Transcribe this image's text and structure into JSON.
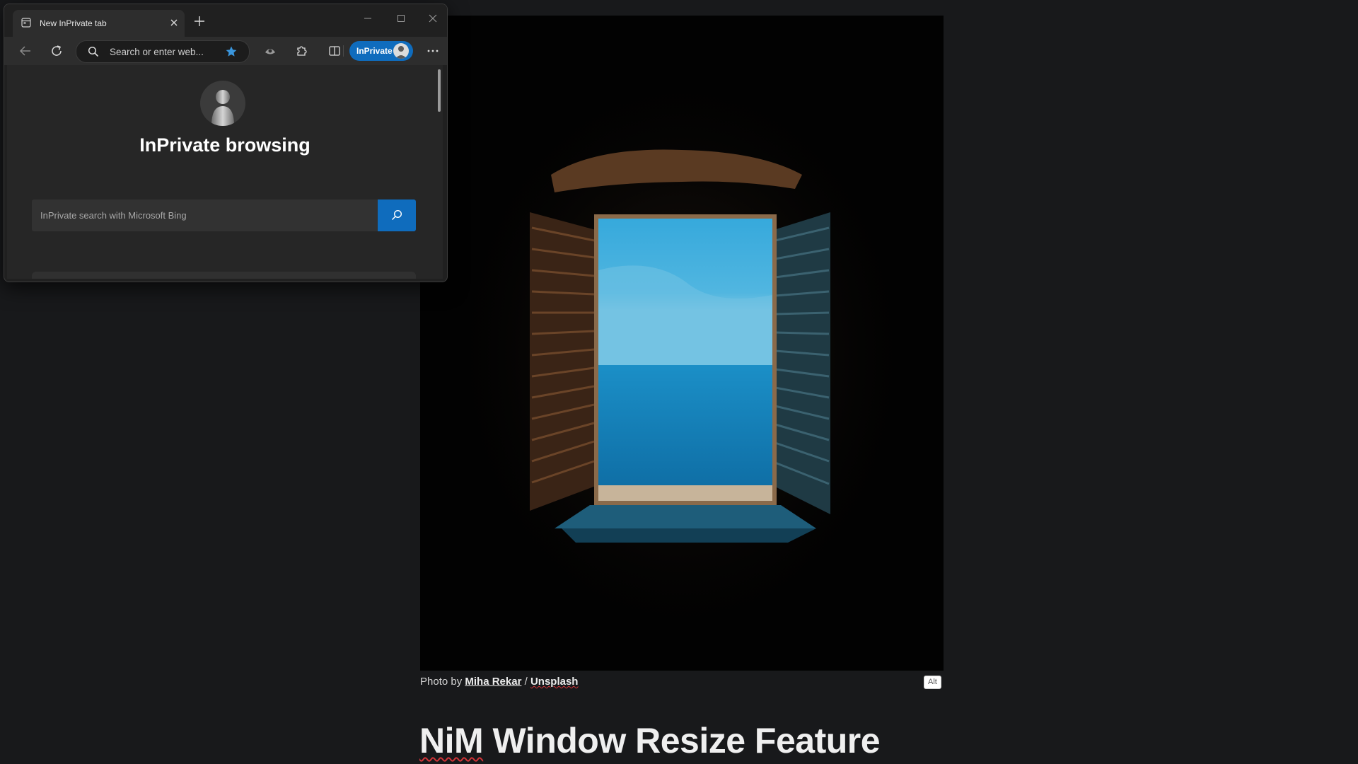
{
  "document": {
    "photo_alt": "Dark room with an open window with wooden shutters looking out on the sea",
    "caption": {
      "prefix": "Photo by ",
      "author": "Miha Rekar",
      "separator": " / ",
      "source": "Unsplash"
    },
    "alt_badge": "Alt",
    "title_first": "NiM",
    "title_rest": " Window Resize Feature"
  },
  "browser": {
    "tab": {
      "title": "New InPrivate tab",
      "icon": "inprivate-page-icon",
      "close_icon": "close-icon"
    },
    "new_tab_icon": "plus-icon",
    "window_controls": [
      "minimize-icon",
      "maximize-icon",
      "close-icon"
    ],
    "toolbar": {
      "back_icon": "back-arrow-icon",
      "refresh_icon": "refresh-icon",
      "address_placeholder": "Search or enter web...",
      "favorite_icon": "star-icon",
      "extension_icons": [
        "tracking-icon",
        "extensions-puzzle-icon",
        "split-screen-icon"
      ],
      "inprivate_label": "InPrivate",
      "more_icon": "ellipsis-icon"
    },
    "new_tab_page": {
      "heading": "InPrivate browsing",
      "search_placeholder": "InPrivate search with Microsoft Bing",
      "search_icon": "search-icon"
    },
    "colors": {
      "accent": "#0f6cbd",
      "frame": "#202020",
      "toolbar": "#2d2d2d",
      "page": "#262626"
    }
  }
}
